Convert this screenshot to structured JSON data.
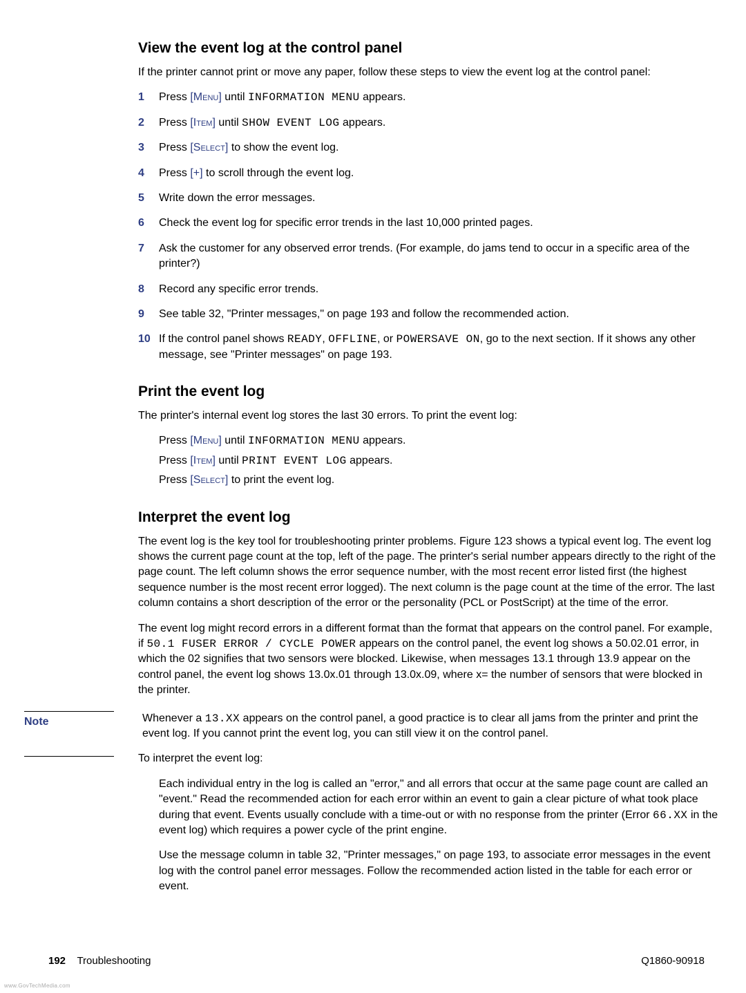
{
  "watermark": "www.GovTechMedia.com",
  "section1": {
    "title": "View the event log at the control panel",
    "intro": "If the printer cannot print or move any paper, follow these steps to view the event log at the control panel:",
    "steps": {
      "s1": {
        "num": "1",
        "p1": "Press ",
        "key": "[Menu]",
        "p2": " until ",
        "lcd": "INFORMATION MENU",
        "p3": " appears."
      },
      "s2": {
        "num": "2",
        "p1": "Press ",
        "key": "[Item]",
        "p2": " until ",
        "lcd": "SHOW EVENT LOG",
        "p3": " appears."
      },
      "s3": {
        "num": "3",
        "p1": "Press ",
        "key": "[Select]",
        "p2": " to show the event log."
      },
      "s4": {
        "num": "4",
        "p1": "Press ",
        "key": "[+]",
        "p2": " to scroll through the event log."
      },
      "s5": {
        "num": "5",
        "text": "Write down the error messages."
      },
      "s6": {
        "num": "6",
        "text": "Check the event log for specific error trends in the last 10,000 printed pages."
      },
      "s7": {
        "num": "7",
        "text": "Ask the customer for any observed error trends. (For example, do jams tend to occur in a specific area of the printer?)"
      },
      "s8": {
        "num": "8",
        "text": "Record any specific error trends."
      },
      "s9": {
        "num": "9",
        "text": "See table 32, \"Printer messages,\" on page 193 and follow the recommended action."
      },
      "s10": {
        "num": "10",
        "p1": "If the control panel shows ",
        "lcd1": "READY",
        "p2": ", ",
        "lcd2": "OFFLINE",
        "p3": ", or ",
        "lcd3": "POWERSAVE ON",
        "p4": ", go to the next section. If it shows any other message, see \"Printer messages\" on page 193."
      }
    }
  },
  "section2": {
    "title": "Print the event log",
    "intro": "The printer's internal event log stores the last 30 errors. To print the event log:",
    "lines": {
      "l1": {
        "p1": "Press ",
        "key": "[Menu]",
        "p2": " until ",
        "lcd": "INFORMATION MENU",
        "p3": " appears."
      },
      "l2": {
        "p1": "Press ",
        "key": "[Item]",
        "p2": " until ",
        "lcd": "PRINT EVENT LOG",
        "p3": " appears."
      },
      "l3": {
        "p1": "Press ",
        "key": "[Select]",
        "p2": " to print the event log."
      }
    }
  },
  "section3": {
    "title": "Interpret the event log",
    "para1": "The event log is the key tool for troubleshooting printer problems. Figure 123 shows a typical event log. The event log shows the current page count at the top, left of the page. The printer's serial number appears directly to the right of the page count. The left column shows the error sequence number, with the most recent error listed first (the highest sequence number is the most recent error logged). The next column is the page count at the time of the error. The last column contains a short description of the error or the personality (PCL or PostScript) at the time of the error.",
    "para2a": "The event log might record errors in a different format than the format that appears on the control panel. For example, if ",
    "para2lcd": "50.1 FUSER ERROR / CYCLE POWER",
    "para2b": " appears on the control panel, the event log shows a 50.02.01 error, in which the 02 signifies that two sensors were blocked. Likewise, when messages 13.1 through 13.9 appear on the control panel, the event log shows 13.0x.01 through 13.0x.09, where x= the number of sensors that were blocked in the printer.",
    "note": {
      "label": "Note",
      "p1": "Whenever a ",
      "lcd": "13.XX",
      "p2": " appears on the control panel, a good practice is to clear all jams from the printer and print the event log. If you cannot print the event log, you can still view it on the control panel."
    },
    "para3": "To interpret the event log:",
    "bullets": {
      "b1a": "Each individual entry in the log is called an \"error,\" and all errors that occur at the same page count are called an \"event.\" Read the recommended action for each error within an event to gain a clear picture of what took place during that event. Events usually conclude with a time-out or with no response from the printer (Error ",
      "b1lcd": "66.XX",
      "b1b": " in the event log) which requires a power cycle of the print engine.",
      "b2": "Use the message column in table 32, \"Printer messages,\" on page 193, to associate error messages in the event log with the control panel error messages. Follow the recommended action listed in the table for each error or event."
    }
  },
  "footer": {
    "page": "192",
    "chapter": "Troubleshooting",
    "docnum": "Q1860-90918"
  }
}
